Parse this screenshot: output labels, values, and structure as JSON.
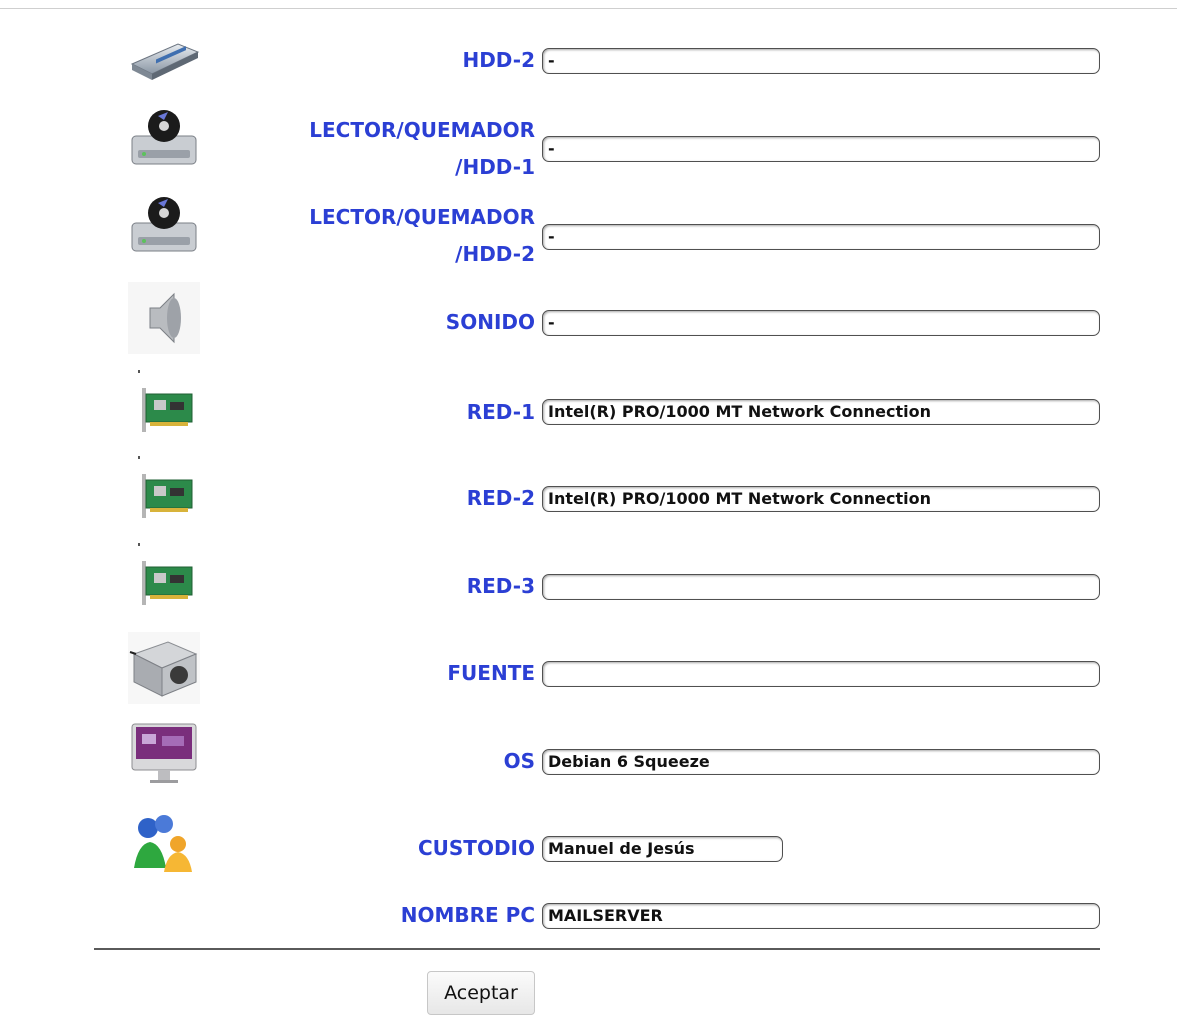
{
  "form": {
    "rows": [
      {
        "key": "hdd2",
        "label": "HDD-2",
        "value": "-",
        "icon": "hard-drive-icon"
      },
      {
        "key": "lector1",
        "label_line1": "LECTOR/QUEMADOR",
        "label_line2": "/HDD-1",
        "value": "-",
        "icon": "optical-drive-icon"
      },
      {
        "key": "lector2",
        "label_line1": "LECTOR/QUEMADOR",
        "label_line2": "/HDD-2",
        "value": "-",
        "icon": "optical-drive-icon"
      },
      {
        "key": "sonido",
        "label": "SONIDO",
        "value": "-",
        "icon": "speaker-icon"
      },
      {
        "key": "red1",
        "label": "RED-1",
        "value": "Intel(R) PRO/1000 MT Network Connection",
        "icon": "network-card-icon"
      },
      {
        "key": "red2",
        "label": "RED-2",
        "value": "Intel(R) PRO/1000 MT Network Connection",
        "icon": "network-card-icon"
      },
      {
        "key": "red3",
        "label": "RED-3",
        "value": "",
        "icon": "network-card-icon"
      },
      {
        "key": "fuente",
        "label": "FUENTE",
        "value": "",
        "icon": "power-supply-icon"
      },
      {
        "key": "os",
        "label": "OS",
        "value": "Debian 6 Squeeze",
        "icon": "monitor-icon"
      },
      {
        "key": "custodio",
        "label": "CUSTODIO",
        "value": "Manuel de Jesús",
        "icon": "users-icon"
      },
      {
        "key": "nombre",
        "label": "NOMBRE PC",
        "value": "MAILSERVER"
      }
    ],
    "submit_label": "Aceptar"
  },
  "colors": {
    "label": "#2b3fd4",
    "divider": "#5a5a5a"
  }
}
